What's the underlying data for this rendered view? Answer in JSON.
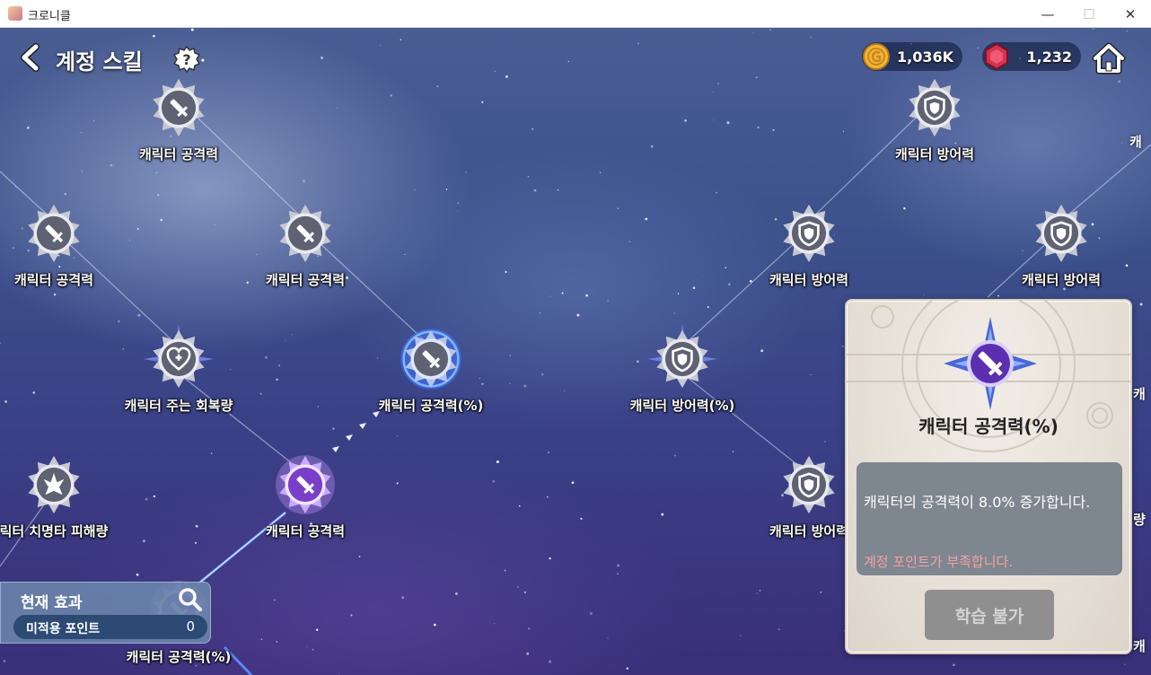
{
  "window": {
    "title": "크로니클",
    "minimize": "—",
    "maximize": "☐",
    "close": "✕"
  },
  "header": {
    "title": "계정 스킬"
  },
  "currency": {
    "gold": "1,036K",
    "gem": "1,232"
  },
  "nodes": [
    {
      "label": "캐릭터 공격력",
      "icon": "sword-icon",
      "state": "locked"
    },
    {
      "label": "캐릭터 방어력",
      "icon": "shield-icon",
      "state": "locked"
    },
    {
      "label": "캐릭터 공격력",
      "icon": "sword-icon",
      "state": "locked"
    },
    {
      "label": "캐릭터 공격력",
      "icon": "sword-icon",
      "state": "locked"
    },
    {
      "label": "캐릭터 방어력",
      "icon": "shield-icon",
      "state": "locked"
    },
    {
      "label": "캐릭터 방어력",
      "icon": "shield-icon",
      "state": "locked"
    },
    {
      "label": "캐릭터 주는 회복량",
      "icon": "heart-icon",
      "state": "locked"
    },
    {
      "label": "캐릭터 공격력(%)",
      "icon": "sword-icon",
      "state": "selected"
    },
    {
      "label": "캐릭터 방어력(%)",
      "icon": "shield-icon",
      "state": "locked"
    },
    {
      "label": "릭터 치명타 피해량",
      "icon": "critical-icon",
      "state": "locked"
    },
    {
      "label": "캐릭터 공격력",
      "icon": "sword-icon",
      "state": "learned"
    },
    {
      "label": "캐릭터 방어력",
      "icon": "shield-icon",
      "state": "locked"
    },
    {
      "label": "캐릭터 공격력(%)",
      "icon": "sword-icon",
      "state": "learned"
    }
  ],
  "edge_labels": {
    "right_top": "캐",
    "right_mid": "캐",
    "right_low": "량",
    "right_bottom": "캐"
  },
  "detail": {
    "title": "캐릭터 공격력(%)",
    "description": "캐릭터의 공격력이 8.0% 증가합니다.",
    "warning": "계정 포인트가 부족합니다.",
    "button": "학습 불가",
    "icon": "sword-icon"
  },
  "effect": {
    "title": "현재 효과",
    "points_label": "미적용 포인트",
    "points_value": "0"
  },
  "colors": {
    "learned": "#7a3fc8",
    "selected_glow": "#2f6cff",
    "warning": "#f5a2a2",
    "button_disabled": "#8f8f8f"
  }
}
